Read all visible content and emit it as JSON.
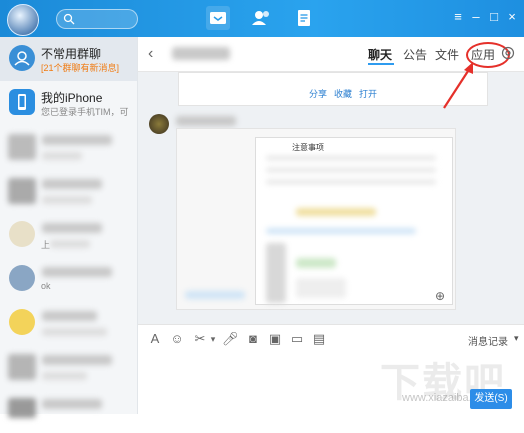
{
  "sidebar": {
    "items": [
      {
        "name": "不常用群聊",
        "sub": "[21个群聊有新消息]"
      },
      {
        "name": "我的iPhone",
        "sub": "您已登录手机TIM，可"
      },
      {
        "name": "",
        "sub": ""
      },
      {
        "name": "",
        "sub": ""
      },
      {
        "name": "",
        "sub": "上"
      },
      {
        "name": "",
        "sub": "ok"
      },
      {
        "name": "",
        "sub": ""
      },
      {
        "name": "",
        "sub": ""
      }
    ]
  },
  "header": {
    "tabs": [
      "聊天",
      "公告",
      "文件",
      "应用"
    ],
    "back_icon": "chevron-left-icon",
    "settings_icon": "gear-icon"
  },
  "chat": {
    "card_links": [
      "分享",
      "收藏",
      "打开"
    ],
    "notice_title": "注意事项"
  },
  "toolbar": {
    "history_label": "消息记录",
    "send_label": "发送(S)"
  },
  "watermark": {
    "big": "下载吧",
    "small": "www.xiazaiba.com"
  },
  "colors": {
    "accent": "#2e9bef",
    "highlight": "#e5302a",
    "orange": "#f07b12"
  }
}
